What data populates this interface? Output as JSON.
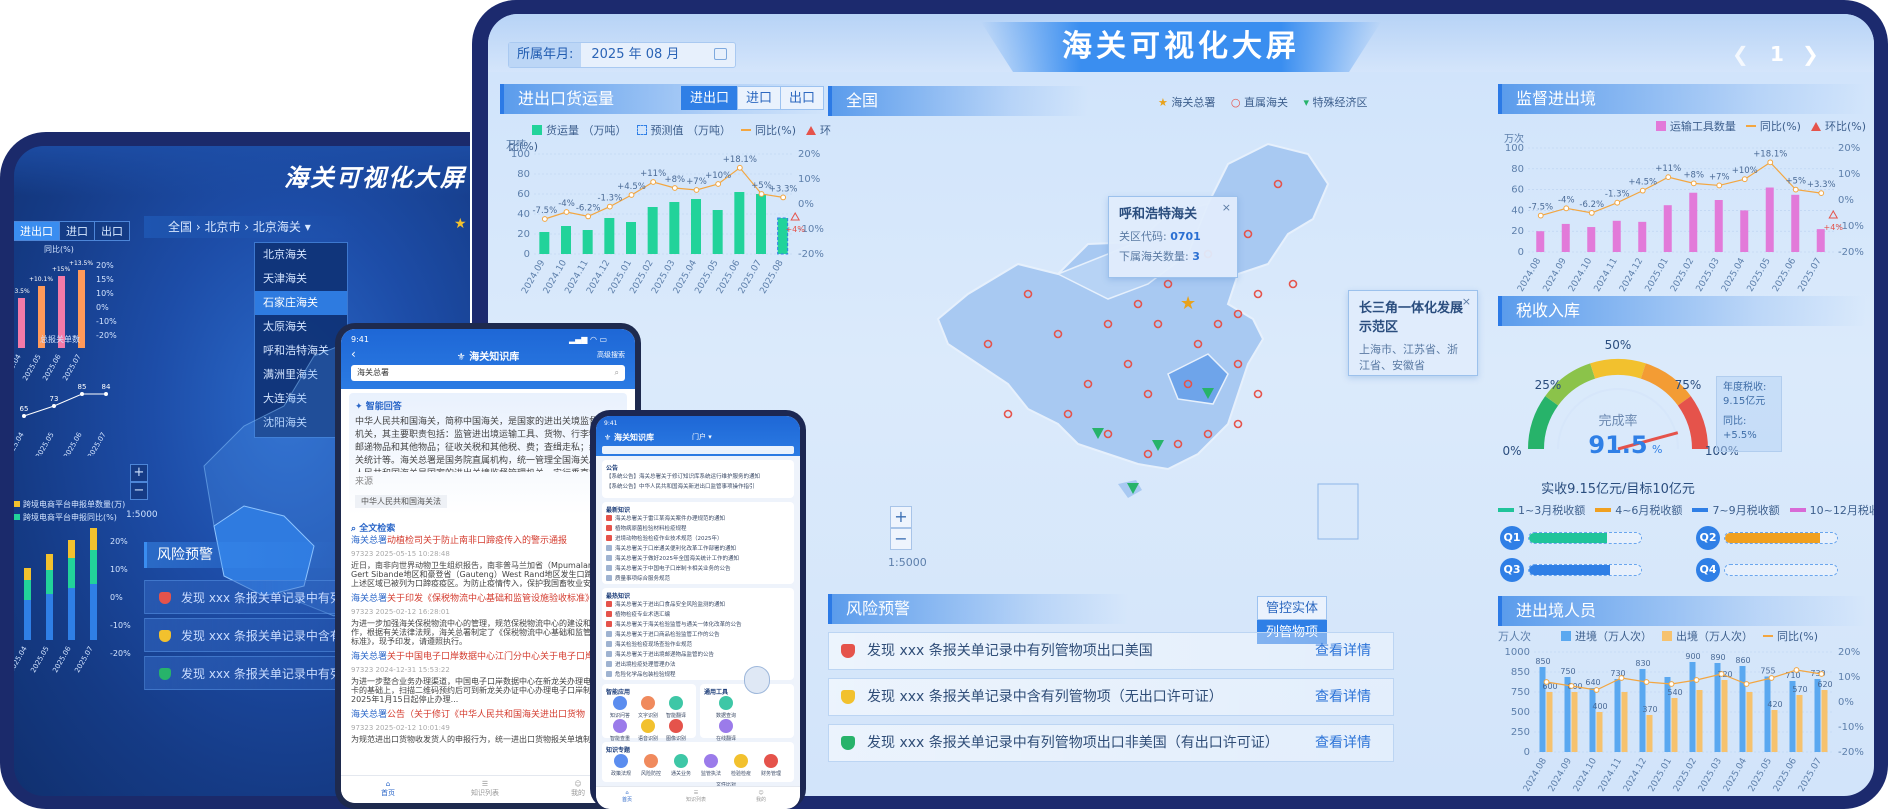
{
  "main": {
    "title": "海关可视化大屏",
    "month_label": "所属年月:",
    "month_value": "2025 年 08 月",
    "page": "1",
    "trade": {
      "title": "进出口货运量",
      "tabs": [
        "进出口",
        "进口",
        "出口"
      ],
      "legend": [
        "货运量 （万吨）",
        "预测值 （万吨）",
        "同比(%)",
        "环比(%)"
      ],
      "unit": "万吨",
      "y_left": [
        "100",
        "80",
        "60",
        "40",
        "20",
        "0"
      ],
      "y_right": [
        "20%",
        "10%",
        "0%",
        "-10%",
        "-20%"
      ],
      "months": [
        "2024.09",
        "2024.10",
        "2024.11",
        "2024.12",
        "2025.01",
        "2025.02",
        "2025.03",
        "2025.04",
        "2025.05",
        "2025.06",
        "2025.07",
        "2025.08"
      ],
      "values": [
        22,
        28,
        24,
        36,
        32,
        47,
        52,
        55,
        44,
        62,
        60,
        36
      ],
      "pct_labels": [
        "-7.5%",
        "-4%",
        "-6.2%",
        "-1.3%",
        "+4.5%",
        "+11%",
        "+8%",
        "+7%",
        "+10%",
        "+18.1%",
        "+5%",
        "+3.3%"
      ],
      "yoy": [
        -7.5,
        -4,
        -6.2,
        -1.3,
        4.5,
        11,
        8,
        7,
        10,
        18.1,
        5,
        3.3
      ],
      "mom_label": "+4%"
    },
    "map": {
      "title": "全国",
      "legend": [
        "海关总署",
        "直属海关",
        "特殊经济区"
      ],
      "popup1": {
        "title": "呼和浩特海关",
        "code_label": "关区代码:",
        "code": "0701",
        "count_label": "下属海关数量:",
        "count": "3"
      },
      "popup2": {
        "title": "长三角一体化发展示范区",
        "body": "上海市、江苏省、浙江省、安徽省"
      },
      "scale": "1:5000"
    },
    "supervise": {
      "title": "监督进出境",
      "unit": "万次",
      "legend": [
        "运输工具数量",
        "同比(%)",
        "环比(%)"
      ],
      "y_left": [
        "100",
        "80",
        "60",
        "40",
        "20",
        "0"
      ],
      "y_right": [
        "20%",
        "10%",
        "0%",
        "-10%",
        "-20%"
      ],
      "months": [
        "2024.08",
        "2024.09",
        "2024.10",
        "2024.11",
        "2024.12",
        "2025.01",
        "2025.02",
        "2025.03",
        "2025.04",
        "2025.05",
        "2025.06",
        "2025.07"
      ],
      "values": [
        20,
        27,
        24,
        30,
        29,
        45,
        57,
        50,
        40,
        62,
        55,
        22
      ],
      "pct_labels": [
        "-7.5%",
        "-4%",
        "-6.2%",
        "-1.3%",
        "+4.5%",
        "+11%",
        "+8%",
        "+7%",
        "+10%",
        "+18.1%",
        "+5%",
        "+3.3%"
      ],
      "yoy": [
        -7.5,
        -4,
        -6.2,
        -1.3,
        4.5,
        11,
        8,
        7,
        10,
        18.1,
        5,
        3.3
      ],
      "mom_label": "+4%"
    },
    "tax": {
      "title": "税收入库",
      "rate_label": "完成率",
      "rate_value": "91.5",
      "rate_unit": "%",
      "rate": 91.5,
      "summary": "实收9.15亿元/目标10亿元",
      "ticks": [
        "0%",
        "25%",
        "50%",
        "75%",
        "100%"
      ],
      "annual_label": "年度税收:",
      "annual_value": "9.15亿元",
      "yoy_label": "同比:",
      "yoy_value": "+5.5%",
      "legend": [
        "1~3月税收额",
        "4~6月税收额",
        "7~9月税收额",
        "10~12月税收额"
      ],
      "quarters": [
        "Q1",
        "Q2",
        "Q3",
        "Q4"
      ],
      "q_fill": [
        0.7,
        0.85,
        0.72,
        0.0
      ],
      "q_colors": [
        "#20c49a",
        "#f0a020",
        "#2f7fe6",
        "#d86ad6"
      ]
    },
    "risk": {
      "title": "风险预警",
      "tabs": [
        "管控实体",
        "列管物项"
      ],
      "items": [
        {
          "text": "发现 xxx 条报关单记录中有列管物项出口美国",
          "more": "查看详情",
          "color": "#e5534b"
        },
        {
          "text": "发现 xxx 条报关单记录中含有列管物项（无出口许可证）",
          "more": "查看详情",
          "color": "#f2c12e"
        },
        {
          "text": "发现 xxx 条报关单记录中有列管物项出口非美国（有出口许可证）",
          "more": "查看详情",
          "color": "#27b36a"
        }
      ]
    },
    "persons": {
      "title": "进出境人员",
      "unit": "万人次",
      "legend": [
        "进境（万人次）",
        "出境（万人次）",
        "同比(%)"
      ],
      "y_left": [
        "1000",
        "850",
        "750",
        "500",
        "250",
        "0"
      ],
      "y_right": [
        "20%",
        "10%",
        "0%",
        "-10%",
        "-20%"
      ],
      "months": [
        "2024.08",
        "2024.09",
        "2024.10",
        "2024.11",
        "2024.12",
        "2025.01",
        "2025.02",
        "2025.03",
        "2025.04",
        "2025.05",
        "2025.06",
        "2025.07"
      ],
      "in": [
        850,
        750,
        640,
        730,
        830,
        750,
        900,
        890,
        860,
        755,
        710,
        730
      ],
      "out": [
        600,
        600,
        400,
        600,
        370,
        540,
        620,
        720,
        600,
        420,
        570,
        620
      ],
      "in_labels": [
        "850",
        "750",
        "640",
        "730",
        "830",
        "",
        "900",
        "890",
        "860",
        "755",
        "710",
        "730"
      ],
      "out_labels": [
        "600",
        "600",
        "400",
        "",
        "370",
        "540",
        "",
        "720",
        "",
        "420",
        "570",
        "620"
      ],
      "yoy": [
        10,
        8,
        6,
        12,
        10,
        9,
        11,
        14,
        9,
        12,
        16,
        14
      ]
    }
  },
  "dark": {
    "title": "海关可视化大屏",
    "tabs": [
      "进出口",
      "进口",
      "出口"
    ],
    "crumb": [
      "全国",
      "北京市",
      "北京海关"
    ],
    "dropdown": [
      "北京海关",
      "天津海关",
      "石家庄海关",
      "太原海关",
      "呼和浩特海关",
      "满洲里海关",
      "大连海关",
      "沈阳海关"
    ],
    "chart1": {
      "legend": "同比(%)",
      "y_right": [
        "20%",
        "15%",
        "10%",
        "0%",
        "-10%",
        "-20%"
      ],
      "months": [
        "2025.04",
        "2025.05",
        "2025.06",
        "2025.07"
      ],
      "pct_labels": [
        "-3.5%",
        "+10.1%",
        "+15%",
        "+13.5%"
      ],
      "values": [
        50,
        62,
        72,
        78
      ]
    },
    "chart2": {
      "legend": "总报关单数",
      "values": [
        "65",
        "73",
        "85",
        "84"
      ],
      "months": [
        "2025.04",
        "2025.05",
        "2025.06",
        "2025.07"
      ]
    },
    "scale": "1:5000",
    "legend_lines": [
      "跨境电商平台申报单数量(万)",
      "跨境电商平台申报同比(%)"
    ],
    "chart3": {
      "y_right": [
        "20%",
        "10%",
        "0%",
        "-10%",
        "-20%"
      ],
      "months": [
        "2025.04",
        "2025.05",
        "2025.06",
        "2025.07"
      ]
    },
    "risk": {
      "title": "风险预警",
      "items": [
        "发现 xxx 条报关单记录中有列管物项",
        "发现 xxx 条报关单记录中含有列管物",
        "发现 xxx 条报关单记录中有列管物项"
      ]
    }
  },
  "tablet": {
    "time": "9:41",
    "title": "海关知识库",
    "adv": "高级搜索",
    "search": "海关总署",
    "ai_title": "智能回答",
    "ai_text": "中华人民共和国海关，简称中国海关，是国家的进出关境监督管理机关，其主要职责包括：监管进出境运输工具、货物、行李物品、邮递物品和其他物品；征收关税和其他税、费；查缉走私；编制海关统计等。海关总署是国务院直属机构，统一管理全国海关。中华人民共和国海关是国家的进出关境监督管理机关，实行垂直管理体制中华人民共和国海关，简称中国海关，是国家的进出关境监督管理机关。",
    "source_label": "来源",
    "source": "中华人民共和国海关法",
    "fulltext_title": "全文检索",
    "results": [
      {
        "k": "海关总署",
        "t": "动植检司关于防止南非口蹄疫传入的警示通报",
        "meta": "97323    2025-05-15  10:28:48",
        "body": "近日，南非向世界动物卫生组织报告，南非普马兰加省（Mpumalanga）Gert Sibande地区和豪登省（Gauteng）West Rand地区发生口蹄疫疫情，上述区域已被列为口蹄疫疫区。为防止疫情传入，保护我国畜牧业安全和生物安全..."
      },
      {
        "k": "海关总署",
        "t": "关于印发《保税物流中心基础和监管设施验收标准》的通知",
        "meta": "97323    2025-02-12  16:28:01",
        "body": "为进一步加强海关保税物流中心的管理，规范保税物流中心的建设和验收工作，根据有关法律法规，海关总署制定了《保税物流中心基础和监管设施验收标准》，现予印发，请遵照执行。"
      },
      {
        "k": "海关总署",
        "t": "关于中国电子口岸数据中心江门分中心关于电子口岸制卡",
        "meta": "97323    2024-12-31  15:53:22",
        "body": "为进一步整合业务办理渠道，中国电子口岸数据中心在新龙关办理电子口岸制卡的基础上，扫描二维码预约后可到新龙关办证中心办理电子口岸制卡业务，2025年1月15日起停止办理..."
      },
      {
        "k": "海关总署",
        "t": "公告（关于修订《中华人民共和国海关进出口货物",
        "meta": "97323    2025-02-12  10:01:49",
        "body": "为规范进出口货物收发货人的申报行为，统一进出口货物报关单填制要求..."
      }
    ],
    "nav": [
      "首页",
      "知识列表",
      "我的"
    ]
  },
  "phone": {
    "time": "9:41",
    "title": "海关知识库",
    "portal": "门户",
    "notice_title": "公告",
    "notices": [
      "【系统公告】海关总署关于修订知识库系统运行维护服务的通知",
      "【系统公告】中华人民共和国海关新进出口监管事项操作指引"
    ],
    "latest_title": "最新知识",
    "latest": [
      "海关总署关于雷江某海关案件办理规范的通知",
      "植物病原菌检验材料检疫规程",
      "进境动物检验检疫作业技术规范（2025年）",
      "海关总署关于口岸通关便利化改革工作部署的通知",
      "海关总署关于做好2025年全国海关统计工作的通知",
      "海关总署关于中国电子口岸制卡相关业务的公告",
      "质量事项综合服务规范"
    ],
    "hot_title": "最热知识",
    "hot": [
      "海关总署关于进出口食品安全风险监测的通知",
      "植物检疫专业术语汇编",
      "海关总署关于海关检验监管与通关一体化改革的公告",
      "海关总署关于进口商品检验监管工作的公告",
      "海关检验检疫现场查验作业规范",
      "海关总署关于进出境邮递物品监管的公告",
      "进出境检疫处理管理办法",
      "危险化学品包装检验规程"
    ],
    "smart_title": "智能应用",
    "smart": [
      "知识问答",
      "文字识别",
      "智能翻译",
      "智能查重",
      "语音识别",
      "图像识别"
    ],
    "tools_title": "通用工具",
    "tools": [
      "数据查询",
      "在线翻译",
      "格式转换",
      "文件比对"
    ],
    "topics_title": "知识专题",
    "topics": [
      "政策法规",
      "风险防控",
      "通关业务",
      "监管执法",
      "检验检疫",
      "财务管理"
    ],
    "nav": [
      "首页",
      "知识列表",
      "我的"
    ]
  },
  "colors": {
    "accent": "#2f7fe6",
    "green_bar": "#22d39a",
    "pink_bar": "#e27ad9",
    "line_orange": "#f3a640"
  }
}
